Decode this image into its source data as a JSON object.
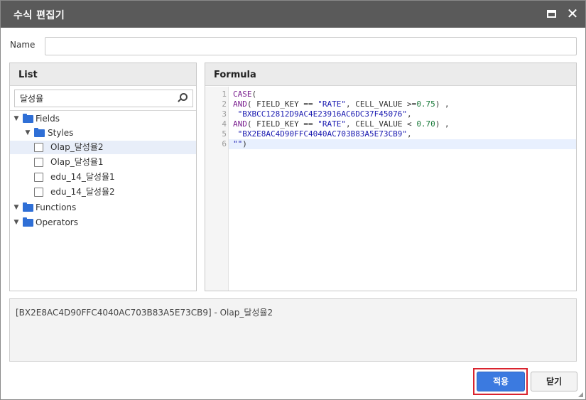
{
  "window": {
    "title": "수식 편집기"
  },
  "name_field": {
    "label": "Name",
    "value": ""
  },
  "list": {
    "header": "List",
    "search_value": "달성율",
    "tree": [
      {
        "label": "Fields",
        "type": "folder",
        "level": 0,
        "expanded": true
      },
      {
        "label": "Styles",
        "type": "folder",
        "level": 1,
        "expanded": true
      },
      {
        "label": "Olap_달성율2",
        "type": "item",
        "level": 2,
        "selected": true
      },
      {
        "label": "Olap_달성율1",
        "type": "item",
        "level": 2
      },
      {
        "label": "edu_14_달성율1",
        "type": "item",
        "level": 2
      },
      {
        "label": "edu_14_달성율2",
        "type": "item",
        "level": 2
      },
      {
        "label": "Functions",
        "type": "folder",
        "level": 0,
        "expanded": true
      },
      {
        "label": "Operators",
        "type": "folder",
        "level": 0,
        "expanded": true
      }
    ]
  },
  "formula": {
    "header": "Formula",
    "line_numbers": [
      "1",
      "2",
      "3",
      "4",
      "5",
      "6"
    ],
    "lines": [
      "CASE(",
      "AND( FIELD_KEY == \"RATE\", CELL_VALUE >=0.75) ,",
      " \"BXBCC12812D9AC4E23916AC6DC37F45076\",",
      "AND( FIELD_KEY == \"RATE\", CELL_VALUE < 0.70) ,",
      " \"BX2E8AC4D90FFC4040AC703B83A5E73CB9\",",
      "\"\")"
    ],
    "active_line": 6
  },
  "description": {
    "text": "[BX2E8AC4D90FFC4040AC703B83A5E73CB9] - Olap_달성율2"
  },
  "buttons": {
    "apply": "적용",
    "close": "닫기"
  },
  "colors": {
    "titlebar": "#5a5a5a",
    "apply_button": "#3b7ae0",
    "folder": "#2f6fd6",
    "highlight_outline": "#d9232e"
  }
}
